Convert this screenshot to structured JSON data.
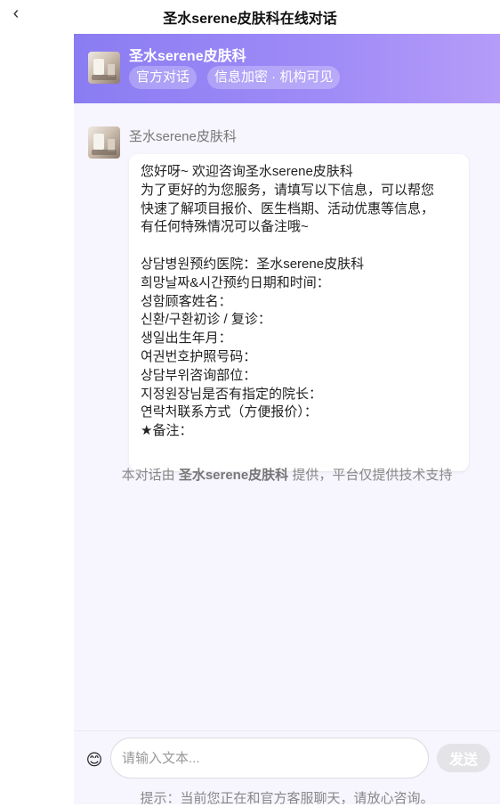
{
  "topbar": {
    "back_icon": "chevron-left-icon",
    "back_glyph": "‹",
    "title": "圣水serene皮肤科在线对话"
  },
  "header": {
    "org_name": "圣水serene皮肤科",
    "tags": [
      "官方对话",
      "信息加密 · 机构可见"
    ]
  },
  "message": {
    "sender": "圣水serene皮肤科",
    "lines": [
      "您好呀~ 欢迎咨询圣水serene皮肤科",
      "为了更好的为您服务，请填写以下信息，可以帮您",
      "快速了解项目报价、医生档期、活动优惠等信息，",
      "有任何特殊情况可以备注哦~",
      "",
      "상담병원预约医院：圣水serene皮肤科",
      "희망날짜&시간预约日期和时间：",
      "성함顾客姓名：",
      "신환/구환初诊 / 复诊：",
      "생일出生年月：",
      "여권번호护照号码：",
      "상담부위咨询部位：",
      "지정원장님是否有指定的院长：",
      "연락처联系方式（方便报价）：",
      "★备注："
    ]
  },
  "footnote": {
    "prefix": "本对话由 ",
    "org": "圣水serene皮肤科",
    "suffix": " 提供，平台仅提供技术支持"
  },
  "composer": {
    "emoji_icon": "smile-emoji-icon",
    "emoji_glyph": "😊",
    "placeholder": "请输入文本...",
    "value": "",
    "send_label": "发送",
    "hint": "提示：当前您正在和官方客服聊天，请放心咨询。"
  },
  "colors": {
    "header_gradient_start": "#8a7cf2",
    "header_gradient_end": "#b59cf9",
    "panel_bg": "#f7f5fd",
    "send_disabled": "#e4e4e8"
  }
}
